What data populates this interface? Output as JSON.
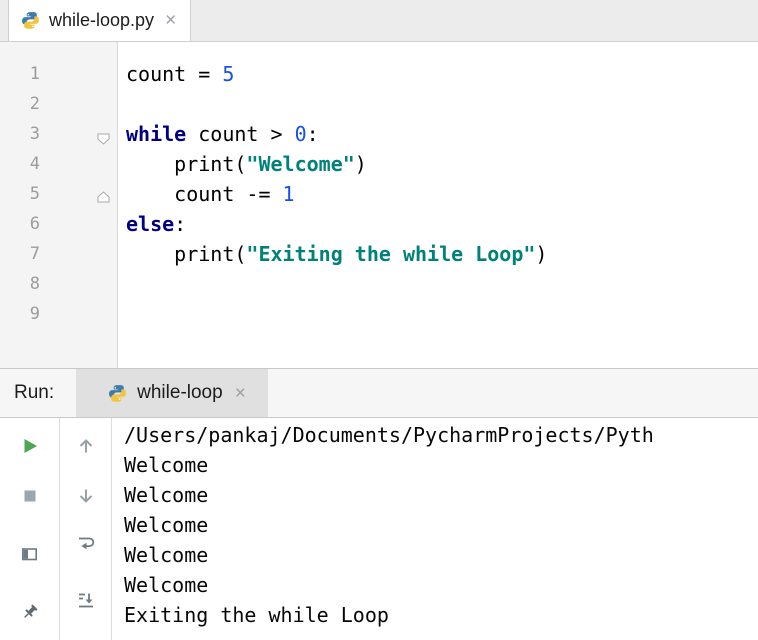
{
  "colors": {
    "keyword": "#000080",
    "number": "#1750EB",
    "string": "#00827A",
    "plain": "#000000",
    "accent_green": "#4DA652"
  },
  "icons": {
    "python-file-icon": "python-logo",
    "close-icon": "×",
    "rerun-icon": "▶",
    "stop-icon": "■",
    "up-arrow-icon": "↑",
    "down-arrow-icon": "↓",
    "soft-wrap-icon": "⮐",
    "scroll-to-end-icon": "⤓",
    "restore-layout-icon": "▤",
    "pin-icon": "pushpin",
    "fold-marker": "pentagon"
  },
  "editor_tab_bar": {
    "tab": {
      "label": "while-loop.py",
      "close_glyph": "×"
    }
  },
  "editor": {
    "line_numbers": [
      "1",
      "2",
      "3",
      "4",
      "5",
      "6",
      "7",
      "8",
      "9"
    ],
    "lines": [
      {
        "tokens": [
          {
            "type": "plain",
            "text": "count = "
          },
          {
            "type": "number",
            "text": "5"
          }
        ]
      },
      {
        "tokens": []
      },
      {
        "tokens": [
          {
            "type": "keyword",
            "text": "while"
          },
          {
            "type": "plain",
            "text": " count > "
          },
          {
            "type": "number",
            "text": "0"
          },
          {
            "type": "plain",
            "text": ":"
          }
        ]
      },
      {
        "tokens": [
          {
            "type": "plain",
            "text": "    print("
          },
          {
            "type": "string",
            "text": "\"Welcome\""
          },
          {
            "type": "plain",
            "text": ")"
          }
        ]
      },
      {
        "tokens": [
          {
            "type": "plain",
            "text": "    count -= "
          },
          {
            "type": "number",
            "text": "1"
          }
        ]
      },
      {
        "tokens": [
          {
            "type": "keyword",
            "text": "else"
          },
          {
            "type": "plain",
            "text": ":"
          }
        ]
      },
      {
        "tokens": [
          {
            "type": "plain",
            "text": "    print("
          },
          {
            "type": "string",
            "text": "\"Exiting the while Loop\""
          },
          {
            "type": "plain",
            "text": ")"
          }
        ]
      },
      {
        "tokens": []
      },
      {
        "tokens": []
      }
    ]
  },
  "run_panel": {
    "header_label": "Run:",
    "tab": {
      "label": "while-loop",
      "close_glyph": "×"
    },
    "console_lines": [
      "/Users/pankaj/Documents/PycharmProjects/Pyth",
      "Welcome",
      "Welcome",
      "Welcome",
      "Welcome",
      "Welcome",
      "Exiting the while Loop"
    ]
  }
}
